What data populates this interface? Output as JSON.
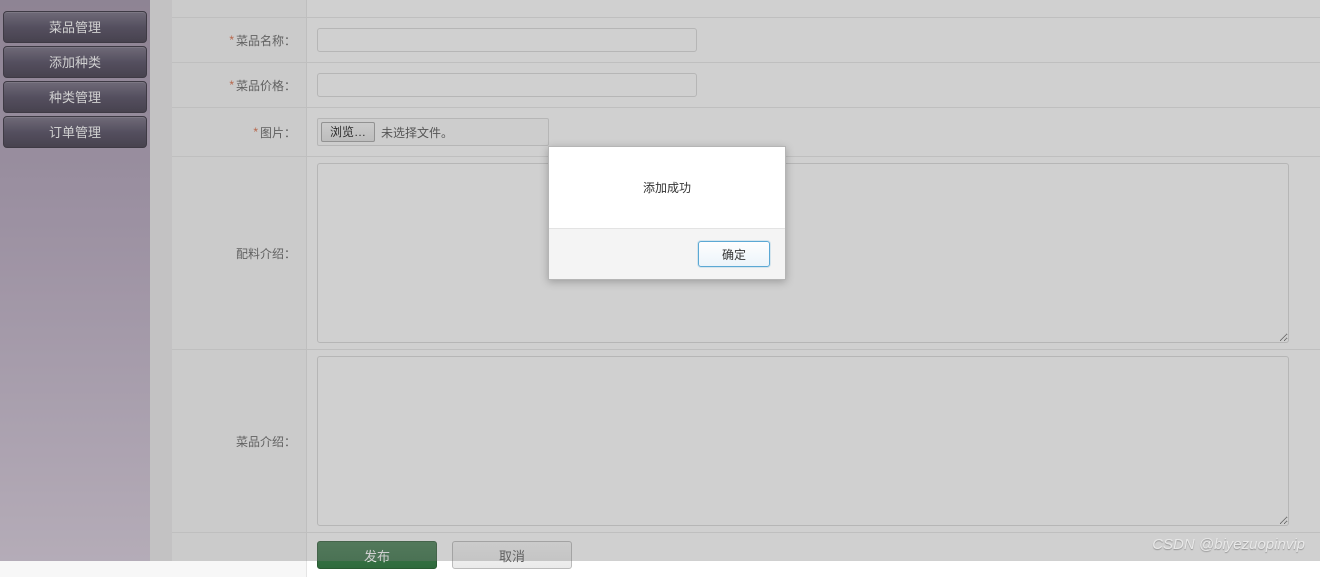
{
  "sidebar": {
    "items": [
      {
        "label": "菜品管理"
      },
      {
        "label": "添加种类"
      },
      {
        "label": "种类管理"
      },
      {
        "label": "订单管理"
      }
    ]
  },
  "form": {
    "name_label": "菜品名称：",
    "name_value": "",
    "price_label": "菜品价格：",
    "price_value": "",
    "image_label": "图片：",
    "browse_label": "浏览…",
    "file_status": "未选择文件。",
    "ingredients_label": "配料介绍：",
    "ingredients_value": "",
    "desc_label": "菜品介绍：",
    "desc_value": "",
    "submit_label": "发布",
    "cancel_label": "取消"
  },
  "modal": {
    "message": "添加成功",
    "ok_label": "确定"
  },
  "watermark": "CSDN @biyezuopinvip"
}
